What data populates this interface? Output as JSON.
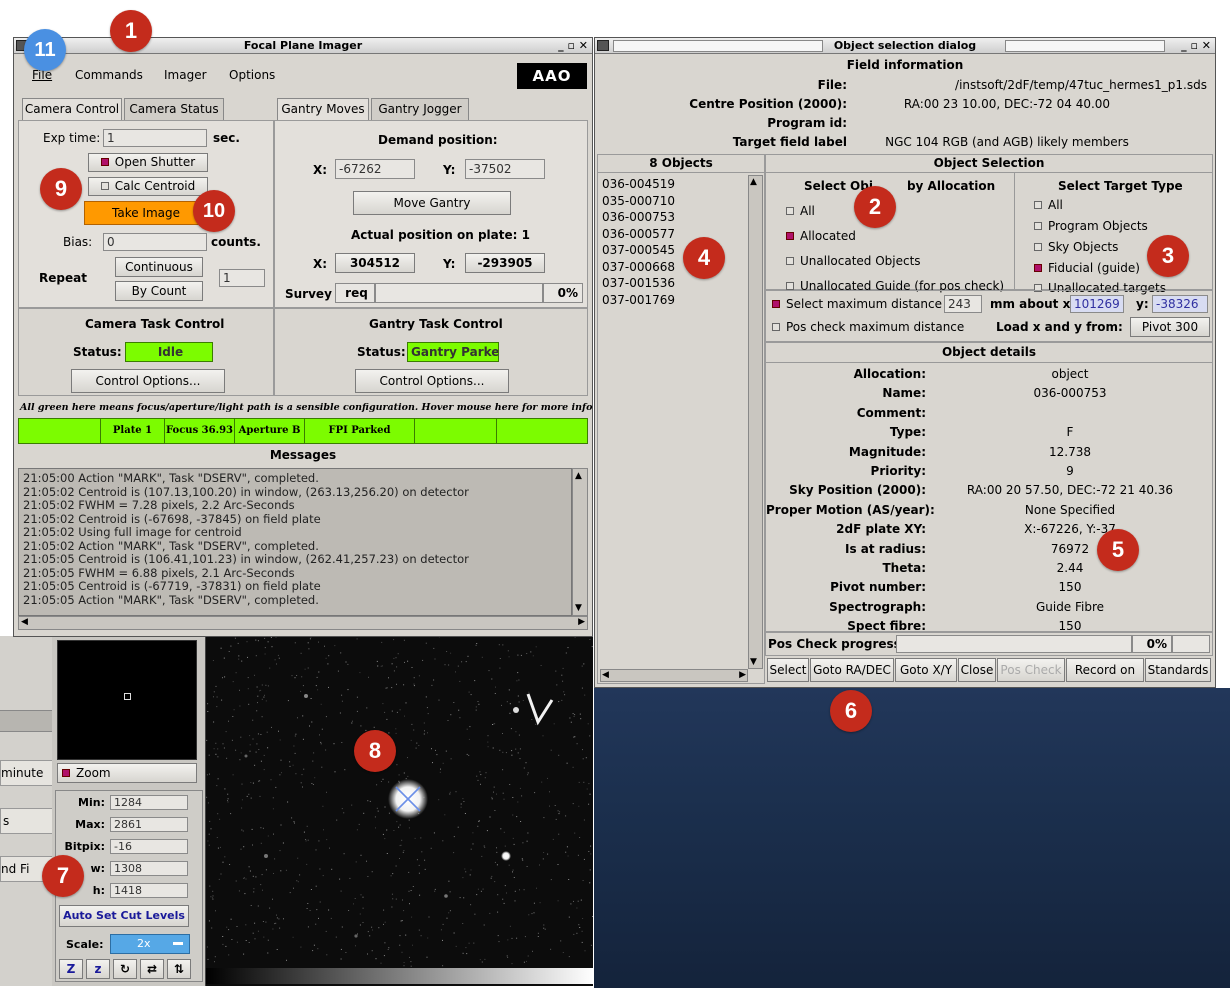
{
  "badges": [
    "1",
    "2",
    "3",
    "4",
    "5",
    "6",
    "7",
    "8",
    "9",
    "10",
    "11"
  ],
  "colors": {
    "accent_red": "#c42b1c",
    "accent_blue": "#4a90e2",
    "status_green": "#7cfc00",
    "take_image_orange": "#ff9900"
  },
  "fpi": {
    "title": "Focal Plane Imager",
    "menu": {
      "file": "File",
      "commands": "Commands",
      "imager": "Imager",
      "options": "Options"
    },
    "logo": "AAO",
    "tabs_left": [
      "Camera Control",
      "Camera Status"
    ],
    "tabs_right": [
      "Gantry Moves",
      "Gantry Jogger"
    ],
    "camera": {
      "exp_time_label": "Exp time:",
      "exp_time_value": "1",
      "exp_time_unit": "sec.",
      "open_shutter": "Open Shutter",
      "calc_centroid": "Calc Centroid",
      "take_image": "Take Image",
      "bias_label": "Bias:",
      "bias_value": "0",
      "bias_unit": "counts.",
      "repeat_label": "Repeat",
      "continuous": "Continuous",
      "by_count": "By Count",
      "count_value": "1"
    },
    "gantry": {
      "demand_title": "Demand position:",
      "x_label": "X:",
      "x_value": "-67262",
      "y_label": "Y:",
      "y_value": "-37502",
      "move_gantry": "Move Gantry",
      "actual_title": "Actual position on plate: 1",
      "actual_x": "304512",
      "actual_y": "-293905",
      "survey_label": "Survey",
      "survey_value": "req",
      "survey_pct": "0%"
    },
    "camera_task": {
      "title": "Camera Task Control",
      "status_label": "Status:",
      "status_value": "Idle",
      "control_options": "Control Options..."
    },
    "gantry_task": {
      "title": "Gantry Task Control",
      "status_label": "Status:",
      "status_value": "Gantry Parked",
      "control_options": "Control Options..."
    },
    "hint": "All green here means focus/aperture/light path is a sensible configuration. Hover mouse here for more info",
    "status_strip": [
      "",
      "Plate 1",
      "Focus 36.93",
      "Aperture B",
      "FPI Parked",
      "",
      ""
    ],
    "messages_title": "Messages",
    "messages": [
      "21:05:00 Action \"MARK\", Task \"DSERV\", completed.",
      "21:05:02 Centroid is (107.13,100.20) in window, (263.13,256.20) on detector",
      "21:05:02 FWHM = 7.28 pixels, 2.2 Arc-Seconds",
      "21:05:02 Centroid is (-67698, -37845) on field plate",
      "21:05:02 Using full image for centroid",
      "21:05:02 Action \"MARK\", Task \"DSERV\", completed.",
      "21:05:05 Centroid is (106.41,101.23) in window, (262.41,257.23) on detector",
      "21:05:05 FWHM = 6.88 pixels, 2.1 Arc-Seconds",
      "21:05:05 Centroid is (-67719, -37831) on field plate",
      "21:05:05 Action \"MARK\", Task \"DSERV\", completed."
    ]
  },
  "osd": {
    "title": "Object selection dialog",
    "field_info_title": "Field information",
    "field_info": [
      {
        "label": "File:",
        "value": "/instsoft/2dF/temp/47tuc_hermes1_p1.sds"
      },
      {
        "label": "Centre Position (2000):",
        "value": "RA:00 23 10.00, DEC:-72 04 40.00"
      },
      {
        "label": "Program id:",
        "value": ""
      },
      {
        "label": "Target field label",
        "value": "NGC 104 RGB (and AGB) likely members"
      }
    ],
    "objects_title": "8 Objects",
    "objects": [
      "036-004519",
      "035-000710",
      "036-000753",
      "036-000577",
      "037-000545",
      "037-000668",
      "037-001536",
      "037-001769"
    ],
    "selection_title": "Object Selection",
    "alloc_title": "Select Objects by Allocation",
    "alloc_title_visible": "Select Obj",
    "alloc_title_tail": "by Allocation",
    "alloc_options": [
      "All",
      "Allocated",
      "Unallocated Objects",
      "Unallocated Guide (for pos check)"
    ],
    "target_title": "Select Target Type",
    "target_options": [
      "All",
      "Program Objects",
      "Sky Objects",
      "Fiducial (guide)",
      "Unallocated targets"
    ],
    "max_dist_label": "Select maximum distance",
    "max_dist_value": "243",
    "mm_about_x": "mm about x:",
    "about_x_value": "101269",
    "about_y_label": "y:",
    "about_y_value": "-38326",
    "pos_check_label": "Pos check maximum distance",
    "load_xy_label": "Load x and y from:",
    "load_xy_button": "Pivot 300",
    "details_title": "Object details",
    "details": [
      {
        "label": "Allocation:",
        "value": "object"
      },
      {
        "label": "Name:",
        "value": "036-000753"
      },
      {
        "label": "Comment:",
        "value": ""
      },
      {
        "label": "Type:",
        "value": "F"
      },
      {
        "label": "Magnitude:",
        "value": "12.738"
      },
      {
        "label": "Priority:",
        "value": "9"
      },
      {
        "label": "Sky Position (2000):",
        "value": "RA:00 20 57.50, DEC:-72 21 40.36"
      },
      {
        "label": "Proper Motion (AS/year):",
        "value": "None Specified"
      },
      {
        "label": "2dF plate XY:",
        "value": "X:-67226, Y:-37"
      },
      {
        "label": "Is at radius:",
        "value": "76972"
      },
      {
        "label": "Theta:",
        "value": "2.44"
      },
      {
        "label": "Pivot number:",
        "value": "150"
      },
      {
        "label": "Spectrograph:",
        "value": "Guide Fibre"
      },
      {
        "label": "Spect fibre:",
        "value": "150"
      }
    ],
    "pos_check_progress": "Pos Check progress",
    "pos_check_pct": "0%",
    "buttons": [
      "Select",
      "Goto RA/DEC",
      "Goto X/Y",
      "Close",
      "Pos Check",
      "Record on",
      "Standards"
    ]
  },
  "viewer": {
    "zoom": "Zoom",
    "stats": [
      {
        "label": "Min:",
        "value": "1284"
      },
      {
        "label": "Max:",
        "value": "2861"
      },
      {
        "label": "Bitpix:",
        "value": "-16"
      },
      {
        "label": "w:",
        "value": "1308"
      },
      {
        "label": "h:",
        "value": "1418"
      }
    ],
    "auto_cut": "Auto Set Cut Levels",
    "scale_label": "Scale:",
    "scale_value": "2x",
    "tool_icons": [
      "Z",
      "z",
      "↻",
      "⇄",
      "⇅"
    ],
    "left_fragments": [
      "minute",
      "s",
      "nd Fi"
    ]
  }
}
